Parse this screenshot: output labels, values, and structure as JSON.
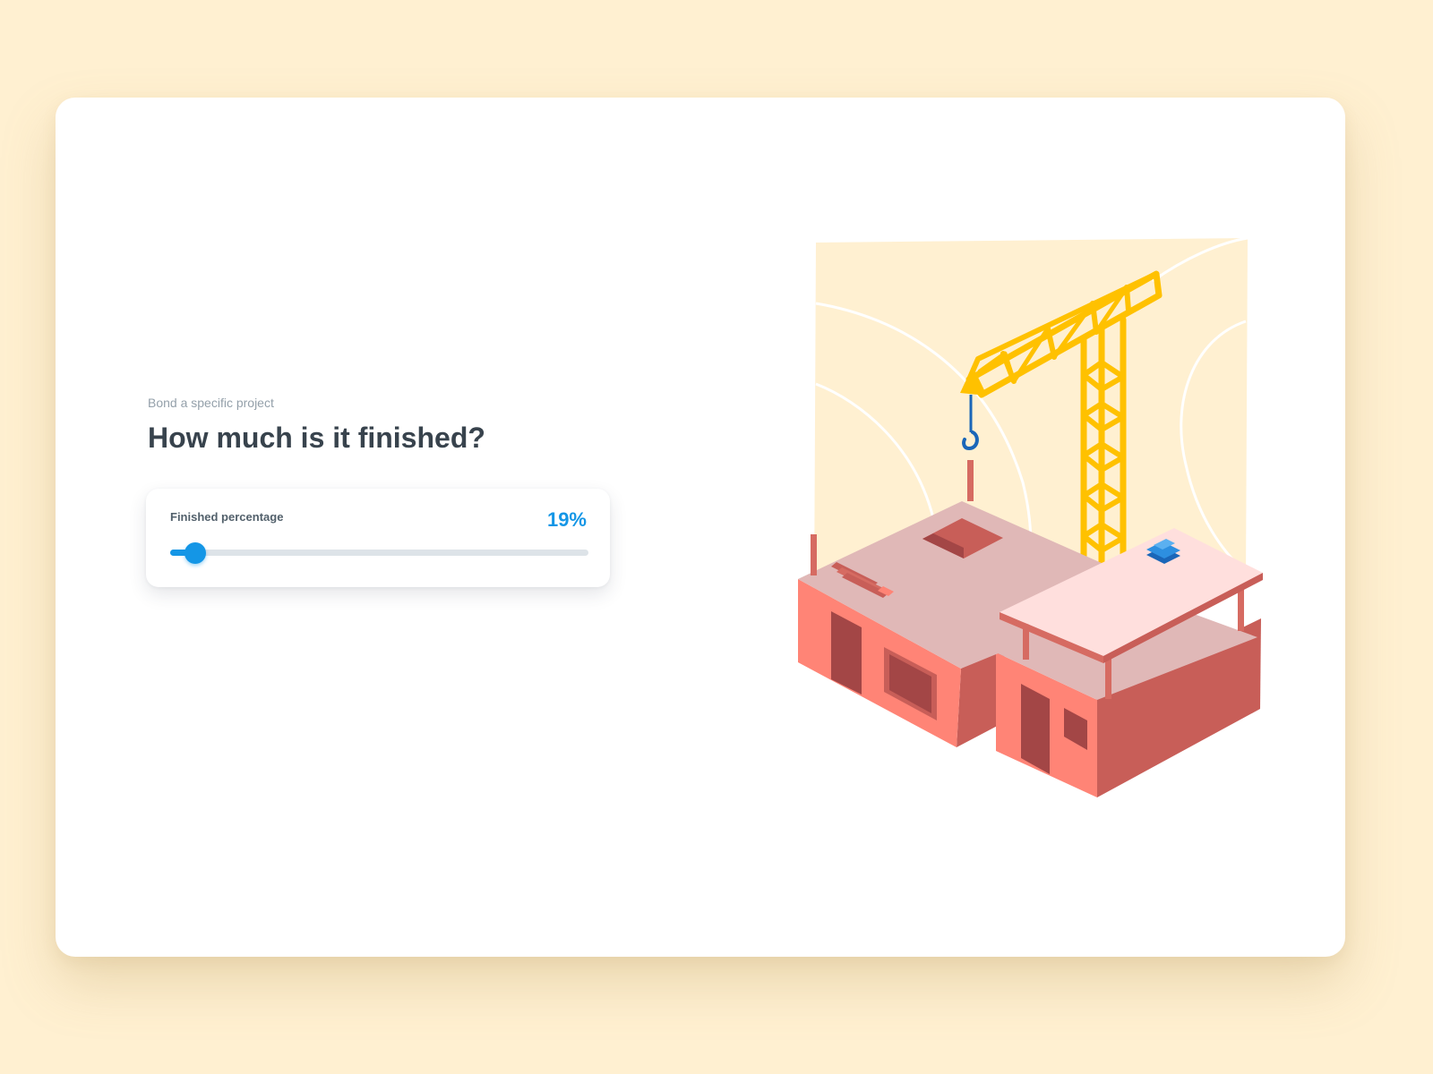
{
  "eyebrow": "Bond a specific project",
  "question": "How much is it finished?",
  "slider": {
    "label": "Finished percentage",
    "value_text": "19%",
    "fraction": 0.06
  },
  "colors": {
    "accent": "#1496e6",
    "page_background": "#fff0d1",
    "crane": "#ffc100",
    "building_wall": "#ff8476",
    "building_shadow": "#c85e58"
  },
  "illustration": {
    "name": "construction-illustration",
    "elements": [
      "crane",
      "hook",
      "building-under-construction",
      "roof",
      "bricks",
      "blue-materials"
    ]
  }
}
